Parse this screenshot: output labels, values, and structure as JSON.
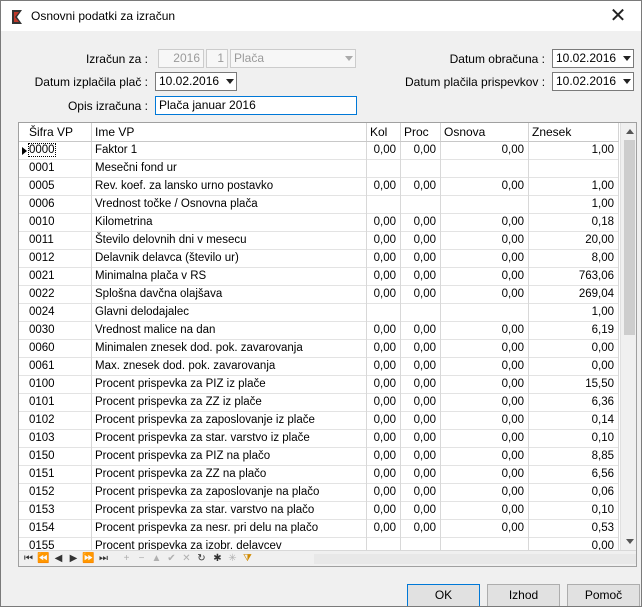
{
  "window": {
    "title": "Osnovni podatki za izračun",
    "close_glyph": "✕"
  },
  "form": {
    "izracun_za_label": "Izračun za :",
    "izracun_year": "2016",
    "izracun_month": "1",
    "izracun_type": "Plača",
    "datum_izplacila_label": "Datum izplačila plač :",
    "datum_izplacila_value": "10.02.2016",
    "opis_label": "Opis izračuna :",
    "opis_value": "Plača januar 2016",
    "datum_obracuna_label": "Datum obračuna :",
    "datum_obracuna_value": "10.02.2016",
    "datum_placila_label": "Datum plačila prispevkov :",
    "datum_placila_value": "10.02.2016"
  },
  "grid": {
    "columns": [
      "Šifra VP",
      "Ime VP",
      "Kol",
      "Proc",
      "Osnova",
      "Znesek"
    ],
    "rows": [
      {
        "sifra": "0000",
        "ime": "Faktor 1",
        "kol": "0,00",
        "proc": "0,00",
        "osnova": "0,00",
        "znesek": "1,00"
      },
      {
        "sifra": "0001",
        "ime": "Mesečni fond ur",
        "kol": "",
        "proc": "",
        "osnova": "",
        "znesek": ""
      },
      {
        "sifra": "0005",
        "ime": "Rev. koef. za lansko urno postavko",
        "kol": "0,00",
        "proc": "0,00",
        "osnova": "0,00",
        "znesek": "1,00"
      },
      {
        "sifra": "0006",
        "ime": "Vrednost točke / Osnovna plača",
        "kol": "",
        "proc": "",
        "osnova": "",
        "znesek": "1,00"
      },
      {
        "sifra": "0010",
        "ime": "Kilometrina",
        "kol": "0,00",
        "proc": "0,00",
        "osnova": "0,00",
        "znesek": "0,18"
      },
      {
        "sifra": "0011",
        "ime": "Število delovnih dni v mesecu",
        "kol": "0,00",
        "proc": "0,00",
        "osnova": "0,00",
        "znesek": "20,00"
      },
      {
        "sifra": "0012",
        "ime": "Delavnik delavca (število ur)",
        "kol": "0,00",
        "proc": "0,00",
        "osnova": "0,00",
        "znesek": "8,00"
      },
      {
        "sifra": "0021",
        "ime": "Minimalna plača v RS",
        "kol": "0,00",
        "proc": "0,00",
        "osnova": "0,00",
        "znesek": "763,06"
      },
      {
        "sifra": "0022",
        "ime": "Splošna davčna olajšava",
        "kol": "0,00",
        "proc": "0,00",
        "osnova": "0,00",
        "znesek": "269,04"
      },
      {
        "sifra": "0024",
        "ime": "Glavni delodajalec",
        "kol": "",
        "proc": "",
        "osnova": "",
        "znesek": "1,00"
      },
      {
        "sifra": "0030",
        "ime": "Vrednost malice na dan",
        "kol": "0,00",
        "proc": "0,00",
        "osnova": "0,00",
        "znesek": "6,19"
      },
      {
        "sifra": "0060",
        "ime": "Minimalen znesek dod. pok. zavarovanja",
        "kol": "0,00",
        "proc": "0,00",
        "osnova": "0,00",
        "znesek": "0,00"
      },
      {
        "sifra": "0061",
        "ime": "Max. znesek dod. pok. zavarovanja",
        "kol": "0,00",
        "proc": "0,00",
        "osnova": "0,00",
        "znesek": "0,00"
      },
      {
        "sifra": "0100",
        "ime": "Procent prispevka za PIZ iz plače",
        "kol": "0,00",
        "proc": "0,00",
        "osnova": "0,00",
        "znesek": "15,50"
      },
      {
        "sifra": "0101",
        "ime": "Procent prispevka za ZZ iz plače",
        "kol": "0,00",
        "proc": "0,00",
        "osnova": "0,00",
        "znesek": "6,36"
      },
      {
        "sifra": "0102",
        "ime": "Procent prispevka za zaposlovanje iz plače",
        "kol": "0,00",
        "proc": "0,00",
        "osnova": "0,00",
        "znesek": "0,14"
      },
      {
        "sifra": "0103",
        "ime": "Procent prispevka za star. varstvo iz plače",
        "kol": "0,00",
        "proc": "0,00",
        "osnova": "0,00",
        "znesek": "0,10"
      },
      {
        "sifra": "0150",
        "ime": "Procent prispevka za PIZ na plačo",
        "kol": "0,00",
        "proc": "0,00",
        "osnova": "0,00",
        "znesek": "8,85"
      },
      {
        "sifra": "0151",
        "ime": "Procent prispevka za ZZ na plačo",
        "kol": "0,00",
        "proc": "0,00",
        "osnova": "0,00",
        "znesek": "6,56"
      },
      {
        "sifra": "0152",
        "ime": "Procent prispevka za zaposlovanje na plačo",
        "kol": "0,00",
        "proc": "0,00",
        "osnova": "0,00",
        "znesek": "0,06"
      },
      {
        "sifra": "0153",
        "ime": "Procent prispevka za star. varstvo na plačo",
        "kol": "0,00",
        "proc": "0,00",
        "osnova": "0,00",
        "znesek": "0,10"
      },
      {
        "sifra": "0154",
        "ime": "Procent prispevka za nesr. pri delu na plačo",
        "kol": "0,00",
        "proc": "0,00",
        "osnova": "0,00",
        "znesek": "0,53"
      },
      {
        "sifra": "0155",
        "ime": "Procent prispevka za izobr. delavcev",
        "kol": "",
        "proc": "",
        "osnova": "",
        "znesek": "0,00"
      }
    ]
  },
  "navigator": {
    "first": "⏮",
    "prior_page": "⏪",
    "prior": "◀",
    "next": "▶",
    "next_page": "⏩",
    "last": "⏭",
    "insert": "+",
    "delete": "−",
    "edit": "▲",
    "post": "✔",
    "cancel": "✕",
    "refresh": "↻",
    "bookmark": "✱",
    "goto_bookmark": "✳",
    "filter": "⧩"
  },
  "buttons": {
    "ok": "OK",
    "izhod": "Izhod",
    "pomoc": "Pomoč"
  }
}
